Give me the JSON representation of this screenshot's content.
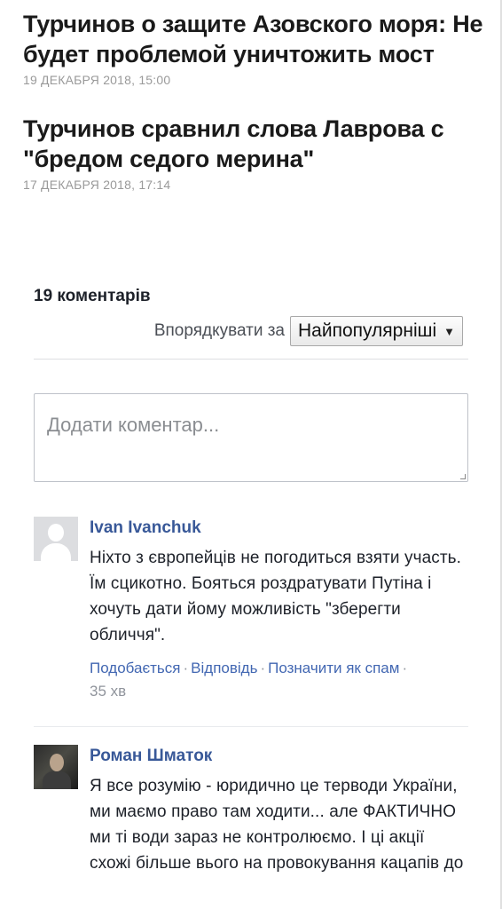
{
  "articles": [
    {
      "title": "Турчинов о защите Азовского моря: Не будет проблемой уничтожить мост",
      "date": "19 ДЕКАБРЯ 2018, 15:00"
    },
    {
      "title": "Турчинов сравнил слова Лаврова с \"бредом седого мерина\"",
      "date": "17 ДЕКАБРЯ 2018, 17:14"
    }
  ],
  "comments_section": {
    "count_label": "19 коментарів",
    "sort_label": "Впорядкувати за",
    "sort_selected": "Найпопулярніші",
    "add_comment_placeholder": "Додати коментар..."
  },
  "comments": [
    {
      "author": "Ivan Ivanchuk",
      "avatar_icon": "default-user-silhouette",
      "text": "Ніхто з європейців не погодиться взяти участь. Їм сцикотно. Бояться роздратувати Путіна і хочуть дати йому можливість \"зберегти обличчя\".",
      "like": "Подобається",
      "reply": "Відповідь",
      "spam": "Позначити як спам",
      "time": "35 хв"
    },
    {
      "author": "Роман Шматок",
      "avatar_icon": "user-photo",
      "text": "Я все розумію - юридично це терводи України, ми маємо право там ходити... але ФАКТИЧНО ми ті води зараз не контролюємо. І ці акції схожі більше вього на провокування кацапів до"
    }
  ],
  "colors": {
    "link": "#385898",
    "action_link": "#4267b2",
    "muted": "#90949c"
  }
}
